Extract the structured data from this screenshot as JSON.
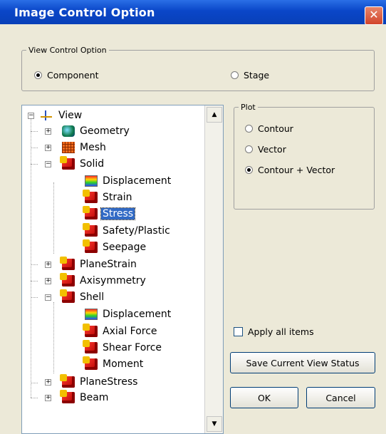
{
  "window": {
    "title": "Image Control Option",
    "close_glyph": "✕"
  },
  "view_control": {
    "legend": "View Control Option",
    "options": [
      {
        "label": "Component",
        "selected": true
      },
      {
        "label": "Stage",
        "selected": false
      }
    ]
  },
  "tree": {
    "items": [
      {
        "label": "View",
        "toggle": "−",
        "icon": "view-axes-icon"
      },
      {
        "label": "Geometry",
        "toggle": "+",
        "icon": "geometry-icon"
      },
      {
        "label": "Mesh",
        "toggle": "+",
        "icon": "mesh-icon"
      },
      {
        "label": "Solid",
        "toggle": "−",
        "icon": "solid-element-icon"
      },
      {
        "label": "Displacement",
        "toggle": "",
        "icon": "displacement-contour-icon"
      },
      {
        "label": "Strain",
        "toggle": "",
        "icon": "result-icon"
      },
      {
        "label": "Stress",
        "toggle": "",
        "icon": "result-icon",
        "selected": true
      },
      {
        "label": "Safety/Plastic",
        "toggle": "",
        "icon": "result-icon"
      },
      {
        "label": "Seepage",
        "toggle": "",
        "icon": "result-icon"
      },
      {
        "label": "PlaneStrain",
        "toggle": "+",
        "icon": "plane-strain-icon"
      },
      {
        "label": "Axisymmetry",
        "toggle": "+",
        "icon": "axisymmetry-icon"
      },
      {
        "label": "Shell",
        "toggle": "−",
        "icon": "shell-element-icon"
      },
      {
        "label": "Displacement",
        "toggle": "",
        "icon": "displacement-contour-icon"
      },
      {
        "label": "Axial Force",
        "toggle": "",
        "icon": "result-icon"
      },
      {
        "label": "Shear Force",
        "toggle": "",
        "icon": "result-icon"
      },
      {
        "label": "Moment",
        "toggle": "",
        "icon": "result-icon"
      },
      {
        "label": "PlaneStress",
        "toggle": "+",
        "icon": "plane-stress-icon"
      },
      {
        "label": "Beam",
        "toggle": "+",
        "icon": "beam-element-icon"
      }
    ],
    "scroll_up_glyph": "▲",
    "scroll_down_glyph": "▼"
  },
  "plot": {
    "legend": "Plot",
    "options": [
      {
        "label": "Contour",
        "selected": false
      },
      {
        "label": "Vector",
        "selected": false
      },
      {
        "label": "Contour + Vector",
        "selected": true
      }
    ]
  },
  "apply_all": {
    "label": "Apply all items",
    "checked": false
  },
  "buttons": {
    "save_view": "Save Current View Status",
    "ok": "OK",
    "cancel": "Cancel"
  }
}
